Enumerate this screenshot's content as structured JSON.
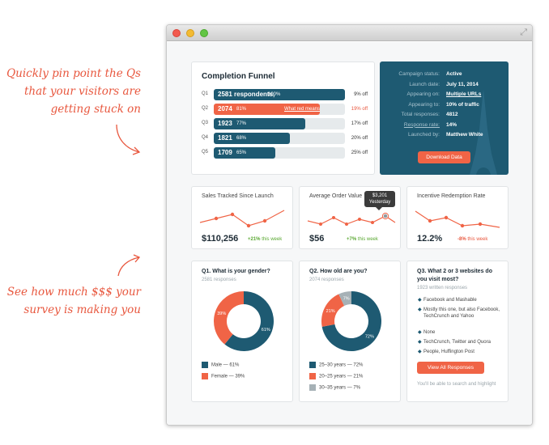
{
  "annotations": {
    "top": "Quickly pin point the Qs that your visitors are getting stuck on",
    "bottom": "See how much $$$ your survey is making you"
  },
  "colors": {
    "navy": "#1e5a72",
    "accent": "#f06446",
    "positive": "#5aa832",
    "negative": "#e8573e",
    "gray": "#a6b1b6"
  },
  "funnel": {
    "title": "Completion Funnel",
    "rows": [
      {
        "q": "Q1",
        "count": "2581 respondents,",
        "pct": "100%",
        "off": "9% off",
        "fill": 1.0
      },
      {
        "q": "Q2",
        "count": "2074",
        "pct": "81%",
        "link": "What red means",
        "off": "19% off",
        "fill": 0.81,
        "highlight": true
      },
      {
        "q": "Q3",
        "count": "1923",
        "pct": "77%",
        "off": "17% off",
        "fill": 0.7
      },
      {
        "q": "Q4",
        "count": "1821",
        "pct": "68%",
        "off": "20% off",
        "fill": 0.58
      },
      {
        "q": "Q5",
        "count": "1709",
        "pct": "65%",
        "off": "25% off",
        "fill": 0.47
      }
    ]
  },
  "campaign": {
    "rows": [
      {
        "label": "Campaign status:",
        "value": "Active"
      },
      {
        "label": "Launch date:",
        "value": "July 11, 2014"
      },
      {
        "label": "Appearing on:",
        "value": "Multiple URLs"
      },
      {
        "label": "Appearing to:",
        "value": "10% of traffic"
      },
      {
        "label": "Total responses:",
        "value": "4812"
      },
      {
        "label": "Response rate:",
        "value": "14%"
      },
      {
        "label": "Launched by:",
        "value": "Matthew White"
      }
    ],
    "download_label": "Download Data"
  },
  "metrics": [
    {
      "title": "Sales Tracked Since Launch",
      "value": "$110,256",
      "change": "+21%",
      "period": "this week",
      "trend": "up"
    },
    {
      "title": "Average Order Value",
      "value": "$56",
      "change": "+7%",
      "period": "this week",
      "trend": "up",
      "tooltip_value": "$3,201",
      "tooltip_label": "Yesterday"
    },
    {
      "title": "Incentive Redemption Rate",
      "value": "12.2%",
      "change": "-8%",
      "period": "this week",
      "trend": "down"
    }
  ],
  "q1": {
    "title": "Q1. What is your gender?",
    "responses": "2581 responses",
    "slices": [
      {
        "label": "Male — 61%",
        "value": 61,
        "pct": "61%",
        "color": "#1e5a72"
      },
      {
        "label": "Female — 39%",
        "value": 39,
        "pct": "39%",
        "color": "#f06446"
      }
    ]
  },
  "q2": {
    "title": "Q2. How old are you?",
    "responses": "2074 responses",
    "slices": [
      {
        "label": "25–30 years — 72%",
        "value": 72,
        "pct": "72%",
        "color": "#1e5a72"
      },
      {
        "label": "20–25 years — 21%",
        "value": 21,
        "pct": "21%",
        "color": "#f06446"
      },
      {
        "label": "30–35 years — 7%",
        "value": 7,
        "pct": "7%",
        "color": "#a6b1b6"
      }
    ]
  },
  "q3": {
    "title": "Q3. What 2 or 3 websites do you visit most?",
    "responses": "1923 written responses",
    "answers": [
      "Facebook and Mashable",
      "Mostly this one, but also Facebook, TechCrunch and Yahoo",
      "None",
      "TechCrunch, Twitter and Quora",
      "People, Huffington Post"
    ],
    "button_label": "View All Responses",
    "note": "You'll be able to search and highlight"
  }
}
